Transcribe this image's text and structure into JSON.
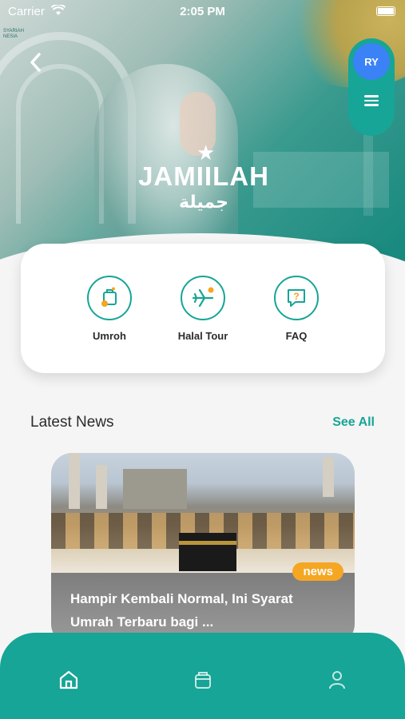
{
  "status": {
    "carrier": "Carrier",
    "time": "2:05 PM"
  },
  "hero": {
    "logo_small": "SYARIAH\nNESIA",
    "brand_name": "JAMIILAH",
    "brand_arabic": "جميلة"
  },
  "user": {
    "initials": "RY"
  },
  "services": [
    {
      "label": "Umroh",
      "icon": "luggage-icon"
    },
    {
      "label": "Halal Tour",
      "icon": "airplane-icon"
    },
    {
      "label": "FAQ",
      "icon": "question-chat-icon"
    }
  ],
  "news": {
    "section_title": "Latest News",
    "see_all": "See All",
    "items": [
      {
        "badge": "news",
        "title": "Hampir Kembali Normal, Ini Syarat Umrah Terbaru bagi ..."
      }
    ]
  },
  "nav": {
    "items": [
      "home-icon",
      "bag-icon",
      "profile-icon"
    ]
  },
  "colors": {
    "accent": "#16a596",
    "badge": "#f5a623",
    "avatar": "#3b82f6"
  }
}
